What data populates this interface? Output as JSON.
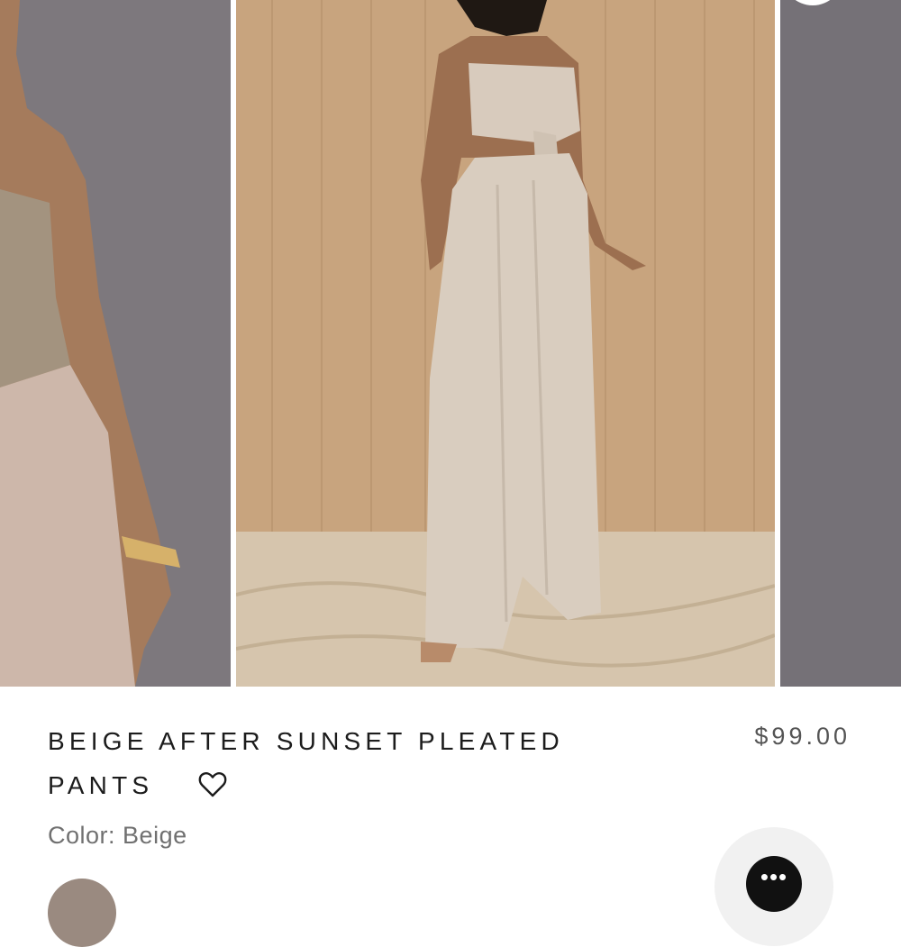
{
  "product": {
    "title_line1": "BEIGE AFTER SUNSET PLEATED",
    "title_line2": "PANTS",
    "price": "$99.00",
    "color_label": "Color:",
    "color_value": "Beige"
  },
  "carousel": {
    "images": [
      {
        "subject": "model in crochet top and beige pleated skirt"
      },
      {
        "subject": "model in beige halter top and pleated wide-leg pants on sand"
      },
      {
        "subject": "grey backdrop"
      }
    ]
  },
  "icons": {
    "wishlist": "heart-icon",
    "chat": "more-dots-icon"
  },
  "chat": {
    "glyph": "•••"
  },
  "colors": {
    "text_primary": "#1c1c1c",
    "text_secondary": "#707070",
    "price": "#555555",
    "chat_button": "#111111"
  }
}
